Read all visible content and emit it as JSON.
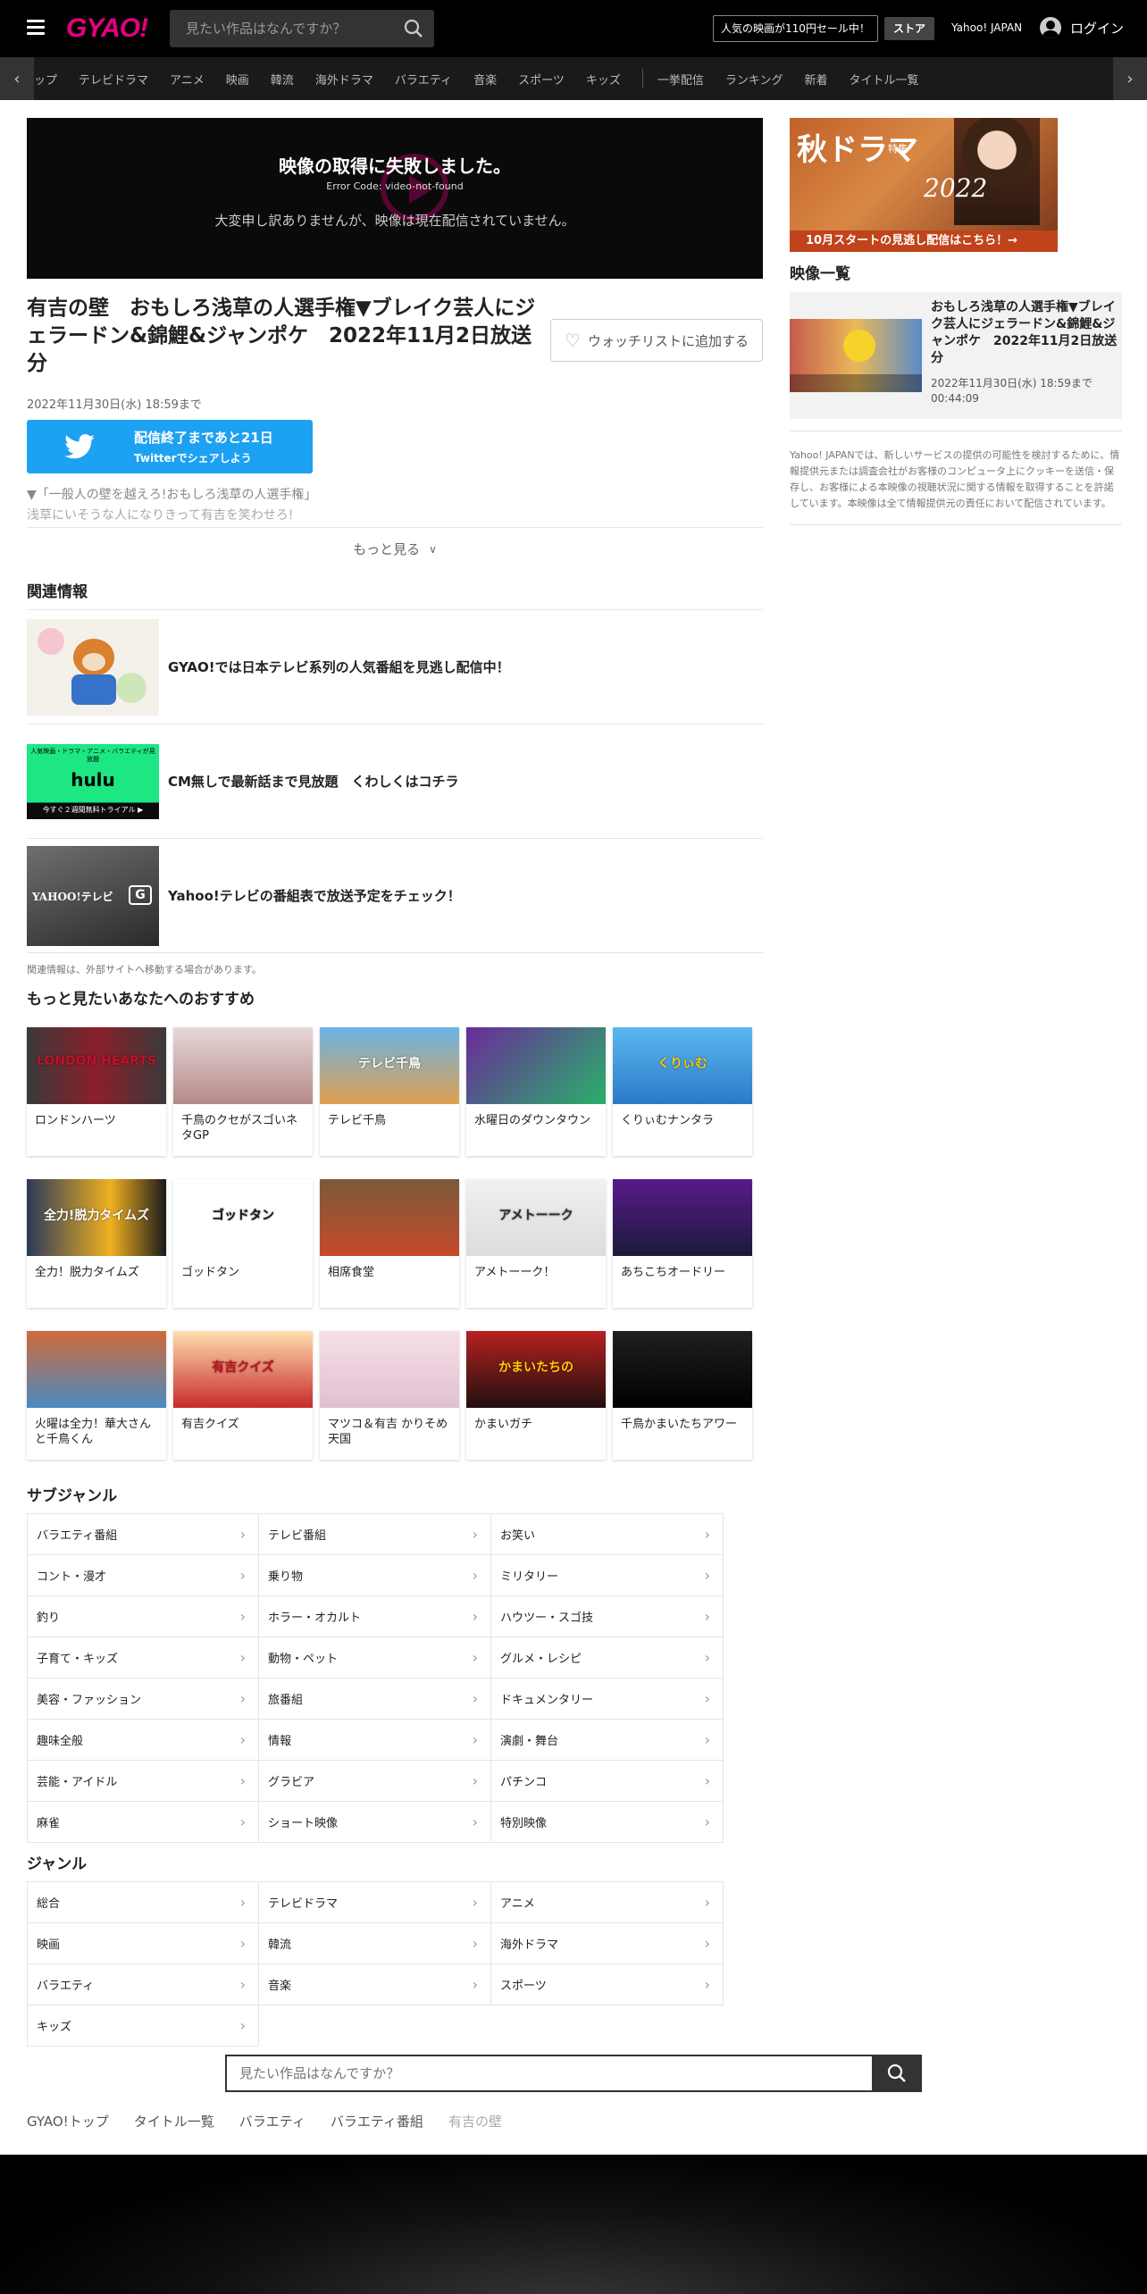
{
  "header": {
    "logo": "GYAO!",
    "search_placeholder": "見たい作品はなんですか？",
    "promo": "人気の映画が110円セール中！",
    "store": "ストア",
    "yahoo_japan": "Yahoo! JAPAN",
    "login": "ログイン"
  },
  "nav": {
    "items": [
      "ップ",
      "テレビドラマ",
      "アニメ",
      "映画",
      "韓流",
      "海外ドラマ",
      "バラエティ",
      "音楽",
      "スポーツ",
      "キッズ"
    ],
    "items2": [
      "一挙配信",
      "ランキング",
      "新着",
      "タイトル一覧"
    ]
  },
  "player": {
    "error_title": "映像の取得に失敗しました。",
    "error_code": "Error Code: video-not-found",
    "error_message": "大変申し訳ありませんが、映像は現在配信されていません。"
  },
  "video": {
    "title": "有吉の壁　おもしろ浅草の人選手権▼ブレイク芸人にジェラードン&錦鯉&ジャンポケ　2022年11月2日放送分",
    "watchlist_label": "ウォッチリストに追加する",
    "deadline": "2022年11月30日(水) 18:59まで",
    "twitter_line1": "配信終了まであと21日",
    "twitter_line2": "Twitterでシェアしよう",
    "desc_line1": "▼「一般人の壁を越えろ!おもしろ浅草の人選手権」",
    "desc_line2": "浅草にいそうな人になりきって有吉を笑わせろ!",
    "more": "もっと見る"
  },
  "related": {
    "heading": "関連情報",
    "items": [
      {
        "text": "GYAO!では日本テレビ系列の人気番組を見逃し配信中！"
      },
      {
        "text": "CM無しで最新話まで見放題　くわしくはコチラ",
        "banner_top": "人気映画・ドラマ・アニメ・バラエティが見放題",
        "banner_logo": "hulu",
        "banner_bottom": "今すぐ２週間無料トライアル ▶"
      },
      {
        "text": "Yahoo!テレビの番組表で放送予定をチェック！",
        "banner_logo": "YAHOO!テレビ",
        "banner_g": "G"
      }
    ],
    "note": "関連情報は、外部サイトへ移動する場合があります。"
  },
  "recommend": {
    "heading": "もっと見たいあなたへのおすすめ",
    "items": [
      {
        "label": "ロンドンハーツ",
        "thumb": "LONDON HEARTS"
      },
      {
        "label": "千鳥のクセがスゴいネタGP",
        "thumb": ""
      },
      {
        "label": "テレビ千鳥",
        "thumb": "テレビ千鳥"
      },
      {
        "label": "水曜日のダウンタウン",
        "thumb": ""
      },
      {
        "label": "くりぃむナンタラ",
        "thumb": "くりぃむ"
      },
      {
        "label": "全力！脱力タイムズ",
        "thumb": "全力!脱力タイムズ"
      },
      {
        "label": "ゴッドタン",
        "thumb": "ゴッドタン"
      },
      {
        "label": "相席食堂",
        "thumb": ""
      },
      {
        "label": "アメトーーク！",
        "thumb": "アメトーーク"
      },
      {
        "label": "あちこちオードリー",
        "thumb": ""
      },
      {
        "label": "火曜は全力！華大さんと千鳥くん",
        "thumb": ""
      },
      {
        "label": "有吉クイズ",
        "thumb": "有吉クイズ"
      },
      {
        "label": "マツコ＆有吉 かりそめ天国",
        "thumb": ""
      },
      {
        "label": "かまいガチ",
        "thumb": "かまいたちの"
      },
      {
        "label": "千鳥かまいたちアワー",
        "thumb": ""
      }
    ]
  },
  "subgenre": {
    "heading": "サブジャンル",
    "items": [
      "バラエティ番組",
      "テレビ番組",
      "お笑い",
      "コント・漫才",
      "乗り物",
      "ミリタリー",
      "釣り",
      "ホラー・オカルト",
      "ハウツー・スゴ技",
      "子育て・キッズ",
      "動物・ペット",
      "グルメ・レシピ",
      "美容・ファッション",
      "旅番組",
      "ドキュメンタリー",
      "趣味全般",
      "情報",
      "演劇・舞台",
      "芸能・アイドル",
      "グラビア",
      "パチンコ",
      "麻雀",
      "ショート映像",
      "特別映像"
    ]
  },
  "genre": {
    "heading": "ジャンル",
    "items": [
      "総合",
      "テレビドラマ",
      "アニメ",
      "映画",
      "韓流",
      "海外ドラマ",
      "バラエティ",
      "音楽",
      "スポーツ",
      "キッズ"
    ]
  },
  "bottom_search": {
    "placeholder": "見たい作品はなんですか？"
  },
  "breadcrumbs": [
    "GYAO!トップ",
    "タイトル一覧",
    "バラエティ",
    "バラエティ番組",
    "有吉の壁"
  ],
  "sidebar": {
    "banner_title": "秋ドラマ",
    "banner_special": "特集",
    "banner_year": "2022",
    "banner_cta": "10月スタートの見逃し配信はこちら！→",
    "list_heading": "映像一覧",
    "item_title": "おもしろ浅草の人選手権▼ブレイク芸人にジェラードン&錦鯉&ジャンポケ　2022年11月2日放送分",
    "item_date": "2022年11月30日(水) 18:59まで",
    "item_duration": "00:44:09",
    "note": "Yahoo! JAPANでは、新しいサービスの提供の可能性を検討するために、情報提供元または調査会社がお客様のコンピュータ上にクッキーを送信・保存し、お客様による本映像の視聴状況に関する情報を取得することを許諾しています。本映像は全て情報提供元の責任において配信されています。"
  },
  "colors": {
    "brand": "#e4007f",
    "twitter": "#1da1f2",
    "header_bg": "#000000"
  }
}
